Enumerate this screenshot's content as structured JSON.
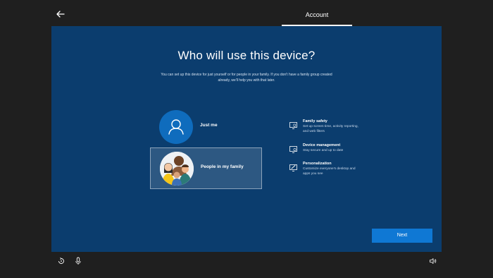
{
  "header": {
    "section_label": "Account"
  },
  "main": {
    "title": "Who will use this device?",
    "subtitle": "You can set up this device for just yourself or for people in your family. If you don't have a family group created already, we'll help you with that later.",
    "options": [
      {
        "label": "Just me",
        "icon": "person-icon",
        "selected": false
      },
      {
        "label": "People in my family",
        "icon": "family-illustration",
        "selected": true
      }
    ],
    "features": [
      {
        "icon": "family-safety-icon",
        "title": "Family safety",
        "description": "Set up screen time, activity reporting, and web filters"
      },
      {
        "icon": "device-management-icon",
        "title": "Device management",
        "description": "Stay secure and up to date"
      },
      {
        "icon": "personalization-icon",
        "title": "Personalization",
        "description": "Customize everyone's desktop and apps you see"
      }
    ],
    "next_label": "Next"
  },
  "footer": {
    "icons": [
      "ease-of-access-icon",
      "microphone-icon",
      "volume-icon"
    ]
  },
  "colors": {
    "page_background": "#1f1f1f",
    "panel_background": "#0b3d6e",
    "accent": "#0f78d4",
    "text": "#ffffff"
  }
}
